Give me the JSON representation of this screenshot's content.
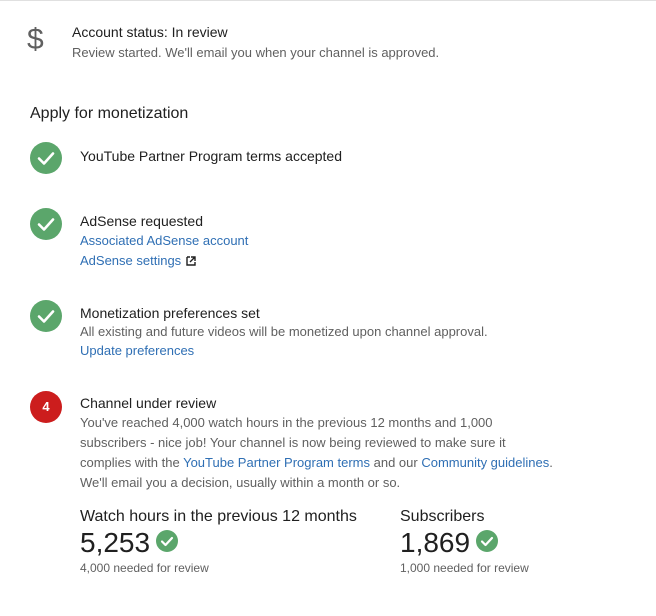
{
  "account_status": {
    "icon": "dollar-icon",
    "title": "Account status: In review",
    "description": "Review started. We'll email you when your channel is approved."
  },
  "section_title": "Apply for monetization",
  "steps": [
    {
      "status": "done",
      "title": "YouTube Partner Program terms accepted"
    },
    {
      "status": "done",
      "title": "AdSense requested",
      "links": [
        "Associated AdSense account",
        "AdSense settings"
      ]
    },
    {
      "status": "done",
      "title": "Monetization preferences set",
      "description": "All existing and future videos will be monetized upon channel approval.",
      "link": "Update preferences"
    },
    {
      "status": "in-progress",
      "number": "4",
      "title": "Channel under review",
      "line1": "You've reached 4,000 watch hours in the previous 12 months and 1,000",
      "line2": "subscribers - nice job! Your channel is now being reviewed to make sure it",
      "line3_prefix": "complies with the ",
      "line3_link1": "YouTube Partner Program terms",
      "line3_mid": " and our ",
      "line3_link2": "Community guidelines",
      "line3_suffix": ".",
      "line4": "We'll email you a decision, usually within a month or so."
    }
  ],
  "metrics": [
    {
      "title": "Watch hours in the previous 12 months",
      "value": "5,253",
      "note": "4,000 needed for review"
    },
    {
      "title": "Subscribers",
      "value": "1,869",
      "note": "1,000 needed for review"
    }
  ],
  "colors": {
    "success": "#5ba66b",
    "alert": "#cc1d1d",
    "link": "#2f6fb4"
  }
}
